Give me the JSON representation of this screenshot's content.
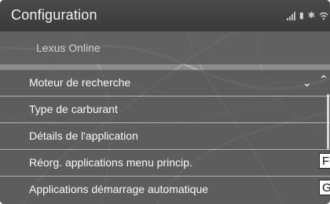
{
  "header": {
    "title": "Configuration",
    "status_icons": [
      "signal-icon",
      "phone-icon",
      "bluetooth-icon",
      "wifi-icon"
    ]
  },
  "sub_item": {
    "label": "Lexus Online"
  },
  "menu": {
    "items": [
      {
        "label": "Moteur de recherche"
      },
      {
        "label": "Type de carburant"
      },
      {
        "label": "Détails de l'application"
      },
      {
        "label": "Réorg. applications menu princip."
      },
      {
        "label": "Applications démarrage automatique"
      }
    ]
  },
  "callouts": [
    "F",
    "G"
  ]
}
